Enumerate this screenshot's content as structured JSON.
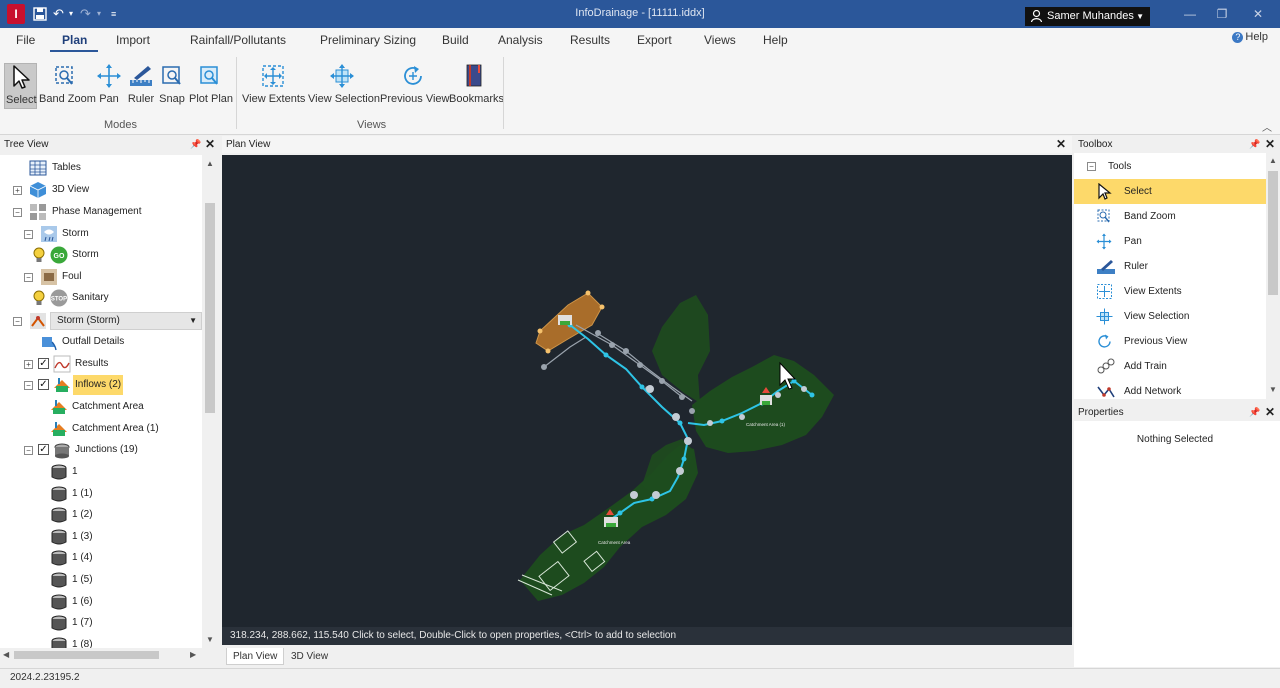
{
  "window": {
    "title": "InfoDrainage - [11111.iddx]",
    "app_logo": "I",
    "user": "Samer Muhandes"
  },
  "menu": {
    "tabs": [
      "File",
      "Plan",
      "Import",
      "Rainfall/Pollutants",
      "Preliminary Sizing",
      "Build",
      "Analysis",
      "Results",
      "Export",
      "Views",
      "Help"
    ],
    "active": "Plan",
    "help": "Help"
  },
  "ribbon": {
    "modes": {
      "label": "Modes",
      "buttons": [
        "Select",
        "Band Zoom",
        "Pan",
        "Ruler",
        "Snap",
        "Plot Plan"
      ]
    },
    "views": {
      "label": "Views",
      "buttons": [
        "View Extents",
        "View Selection",
        "Previous View",
        "Bookmarks"
      ]
    }
  },
  "tree_view": {
    "title": "Tree View",
    "items": [
      {
        "label": "Tables"
      },
      {
        "label": "3D View"
      },
      {
        "label": "Phase Management"
      },
      {
        "label": "Storm"
      },
      {
        "label": "Storm"
      },
      {
        "label": "Foul"
      },
      {
        "label": "Sanitary"
      },
      {
        "label": "Storm (Storm)"
      },
      {
        "label": "Outfall Details"
      },
      {
        "label": "Results"
      },
      {
        "label": "Inflows (2)"
      },
      {
        "label": "Catchment Area"
      },
      {
        "label": "Catchment Area (1)"
      },
      {
        "label": "Junctions (19)"
      },
      {
        "label": "1"
      },
      {
        "label": "1 (1)"
      },
      {
        "label": "1 (2)"
      },
      {
        "label": "1 (3)"
      },
      {
        "label": "1 (4)"
      },
      {
        "label": "1 (5)"
      },
      {
        "label": "1 (6)"
      },
      {
        "label": "1 (7)"
      },
      {
        "label": "1 (8)"
      }
    ]
  },
  "plan_view": {
    "title": "Plan View",
    "coords": "318.234, 288.662, 115.540",
    "hint": "Click to select, Double-Click to open properties, <Ctrl> to add to selection",
    "tabs": [
      "Plan View",
      "3D View"
    ],
    "map_labels": [
      "Catchment Area (1)",
      "Catchment Area"
    ]
  },
  "toolbox": {
    "title": "Toolbox",
    "section": "Tools",
    "items": [
      "Select",
      "Band Zoom",
      "Pan",
      "Ruler",
      "View Extents",
      "View Selection",
      "Previous View",
      "Add Train",
      "Add Network"
    ],
    "selected": "Select"
  },
  "properties": {
    "title": "Properties",
    "empty": "Nothing Selected"
  },
  "status": {
    "version": "2024.2.23195.2"
  },
  "colors": {
    "titlebar": "#2b579a",
    "highlight": "#fdd96a",
    "canvas": "#1f262e",
    "catchment": "#1e4d1e",
    "pipe": "#2ec4e6"
  }
}
